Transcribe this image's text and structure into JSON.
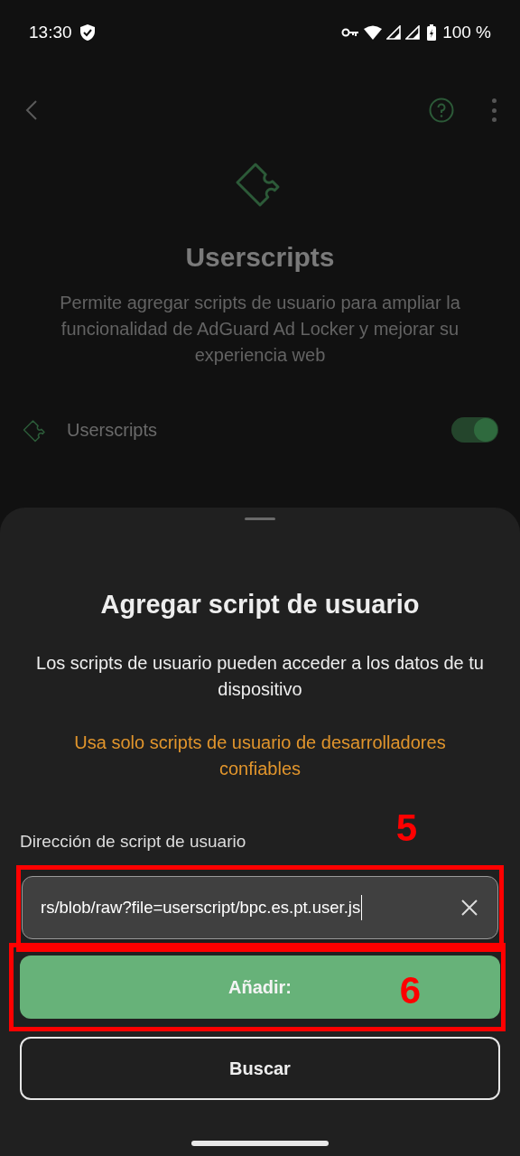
{
  "status_bar": {
    "time": "13:30",
    "battery": "100 %"
  },
  "page": {
    "title": "Userscripts",
    "description": "Permite agregar scripts de usuario para ampliar la funcionalidad de AdGuard Ad Locker y mejorar su experiencia web",
    "toggle": {
      "label": "Userscripts",
      "on": true
    }
  },
  "sheet": {
    "title": "Agregar script de usuario",
    "text": "Los scripts de usuario pueden acceder a los datos de tu dispositivo",
    "warning": "Usa solo scripts de usuario de desarrolladores confiables",
    "field": {
      "label": "Dirección de script de usuario",
      "value": "rs/blob/raw?file=userscript/bpc.es.pt.user.js"
    },
    "buttons": [
      {
        "label": "Añadir:",
        "kind": "primary"
      },
      {
        "label": "Buscar",
        "kind": "outline"
      }
    ]
  },
  "annotations": [
    {
      "label": "5"
    },
    {
      "label": "6"
    }
  ]
}
